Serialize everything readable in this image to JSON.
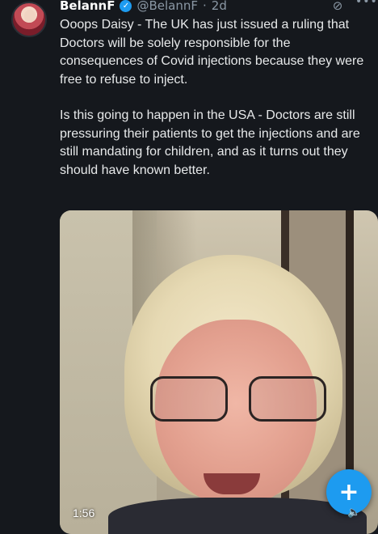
{
  "author": {
    "name": "BelannF",
    "handle": "@BelannF",
    "separator": "·",
    "time": "2d",
    "verified_icon": "verified-badge-icon"
  },
  "icons": {
    "grok": "grok-icon",
    "more": "more-icon",
    "compose": "plus-icon",
    "volume": "volume-icon"
  },
  "tweet": {
    "paragraph1": "Ooops Daisy - The UK has just issued a ruling that Doctors will be solely responsible for the consequences of Covid injections because they were free to refuse to inject.",
    "paragraph2": "Is this going to happen in the USA - Doctors are still pressuring their patients to get the injections and are still mandating for children, and as it turns out they should have known better."
  },
  "video": {
    "timestamp": "1:56"
  },
  "colors": {
    "background": "#15181d",
    "accent": "#1d9bf0",
    "secondary_text": "#8b98a5"
  }
}
